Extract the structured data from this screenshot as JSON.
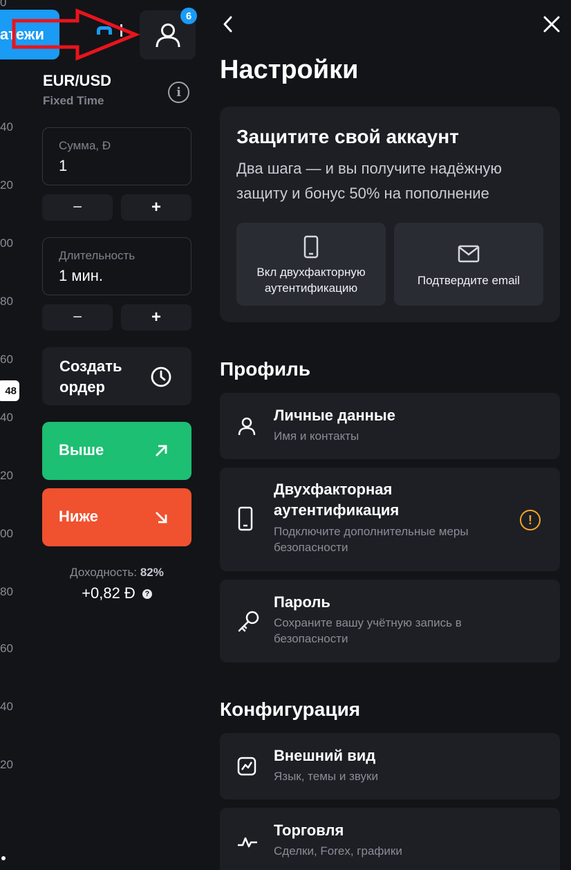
{
  "colors": {
    "background": "#131418",
    "card": "#1d1f25",
    "accent": "#1a9bf5",
    "up": "#1dbf73",
    "down": "#f0512f",
    "warning": "#f5a623",
    "annotation": "#e8141c"
  },
  "chart": {
    "y_ticks": [
      "0",
      "40",
      "20",
      "00",
      "80",
      "60",
      "40",
      "20",
      "00",
      "80",
      "60",
      "40",
      "20"
    ],
    "price_badge": "48"
  },
  "topbar": {
    "payments_label": "атежи",
    "profile_icon": "user-icon",
    "notifications_count": "6"
  },
  "trade": {
    "pair": "EUR/USD",
    "mode": "Fixed Time",
    "amount": {
      "label": "Сумма, Đ",
      "value": "1"
    },
    "duration": {
      "label": "Длительность",
      "value": "1 мин."
    },
    "minus": "−",
    "plus": "+",
    "order_label": "Создать ордер",
    "up_label": "Выше",
    "down_label": "Ниже",
    "yield_label": "Доходность:",
    "yield_value": "82%",
    "profit": "+0,82 Đ"
  },
  "settings": {
    "title": "Настройки",
    "protect": {
      "heading": "Защитите свой аккаунт",
      "text": "Два шага — и вы получите надёжную защиту и бонус 50% на пополнение",
      "tile_2fa": "Вкл двухфакторную аутентификацию",
      "tile_email": "Подтвердите email"
    },
    "profile_section": "Профиль",
    "personal": {
      "title": "Личные данные",
      "subtitle": "Имя и контакты"
    },
    "twofa": {
      "title": "Двухфакторная аутентификация",
      "subtitle": "Подключите дополнительные меры безопасности"
    },
    "password": {
      "title": "Пароль",
      "subtitle": "Сохраните вашу учётную запись в безопасности"
    },
    "config_section": "Конфигурация",
    "appearance": {
      "title": "Внешний вид",
      "subtitle": "Язык, темы и звуки"
    },
    "trading": {
      "title": "Торговля",
      "subtitle": "Сделки, Forex, графики"
    }
  }
}
